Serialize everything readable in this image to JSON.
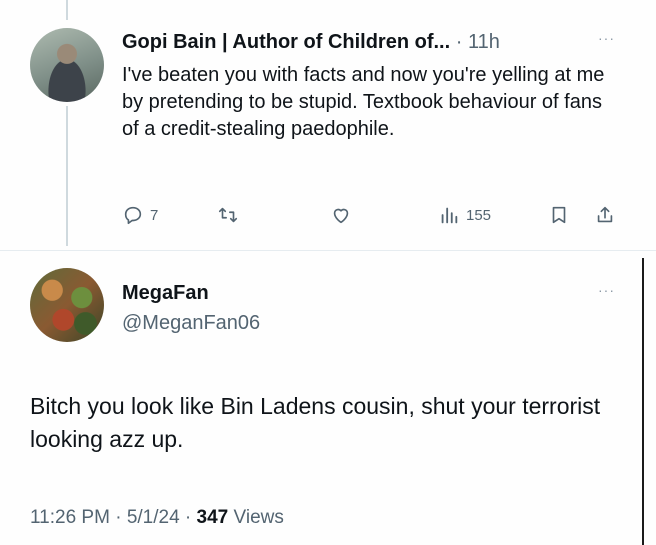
{
  "reply_tweet": {
    "author_name": "Gopi Bain | Author of Children of...",
    "separator": " · ",
    "time": "11h",
    "more": "···",
    "text": "I've beaten you with facts and now you're yelling at me by pretending to be stupid. Textbook behaviour of fans of a credit-stealing paedophile.",
    "actions": {
      "replies": "7",
      "retweets": "",
      "likes": "",
      "views": "155"
    }
  },
  "main_tweet": {
    "author_name": "MegaFan",
    "handle": "@MeganFan06",
    "more": "···",
    "text": "Bitch you look like Bin Ladens cousin, shut your terrorist looking azz up.",
    "time": "11:26 PM",
    "dot1": " · ",
    "date": "5/1/24",
    "dot2": " · ",
    "views_count": "347",
    "views_label": " Views"
  },
  "colors": {
    "text": "#0f1419",
    "secondary": "#536471",
    "divider": "#e6ecf0"
  },
  "icons": [
    "more-icon",
    "reply-icon",
    "retweet-icon",
    "like-icon",
    "views-icon",
    "bookmark-icon",
    "share-icon"
  ]
}
